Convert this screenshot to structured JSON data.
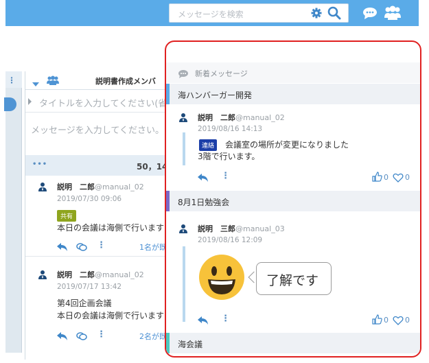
{
  "header": {
    "search_placeholder": "メッセージを検索",
    "icons": [
      "gear-icon",
      "search-icon",
      "chat-icon",
      "users-icon"
    ],
    "accent": "#5aabe8"
  },
  "column": {
    "title": "説明書作成メンバ",
    "title_placeholder": "タイトルを入力してください(省",
    "message_placeholder": "メッセージを入力してください。",
    "count": "50，14",
    "posts": [
      {
        "name": "説明　二郎",
        "id": "@manual_02",
        "date": "2019/07/30 09:06",
        "tag": "共有",
        "lines": [
          "本日の会議は海側で行います"
        ],
        "read": "1名が既"
      },
      {
        "name": "説明　二郎",
        "id": "@manual_02",
        "date": "2019/07/17 13:42",
        "lines": [
          "第4回企画会議",
          "本日の会議は海側で行います"
        ],
        "read": "2名が既"
      }
    ]
  },
  "panel": {
    "header": "新着メッセージ",
    "groups": [
      {
        "name": "海ハンバーガー開発",
        "color": "#5aabe8"
      },
      {
        "name": "8月1日勉強会",
        "color": "#7b68c8"
      },
      {
        "name": "海会議",
        "color": "#4cc9c0"
      }
    ],
    "messages": [
      {
        "name": "説明　二郎",
        "id": "@manual_02",
        "date": "2019/08/16 14:13",
        "badge": "連絡",
        "line1": "会議室の場所が変更になりました",
        "line2": "3階で行います。",
        "likes": "0",
        "hearts": "0"
      },
      {
        "name": "説明　三郎",
        "id": "@manual_03",
        "date": "2019/08/16 12:09",
        "stamp_text": "了解です",
        "likes": "0",
        "hearts": "0"
      }
    ],
    "highlight_color": "#e02020"
  }
}
